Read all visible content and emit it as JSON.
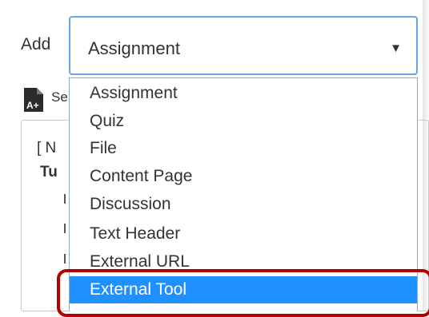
{
  "add_label": "Add",
  "select": {
    "value": "Assignment",
    "caret": "▼"
  },
  "behind": {
    "s_text": "Se",
    "n_text": "[ N",
    "tu_text": "Tu"
  },
  "dropdown": {
    "options": [
      {
        "label": "Assignment",
        "selected": false
      },
      {
        "label": "Quiz",
        "selected": false
      },
      {
        "label": "File",
        "selected": false
      },
      {
        "label": "Content Page",
        "selected": false
      },
      {
        "label": "Discussion",
        "selected": false
      },
      {
        "label": "Text Header",
        "selected": false
      },
      {
        "label": "External URL",
        "selected": false
      },
      {
        "label": "External Tool",
        "selected": true
      }
    ]
  },
  "colors": {
    "selected_bg": "#1e90ff",
    "focus_border": "#66a6e6",
    "highlight": "#b30000"
  }
}
